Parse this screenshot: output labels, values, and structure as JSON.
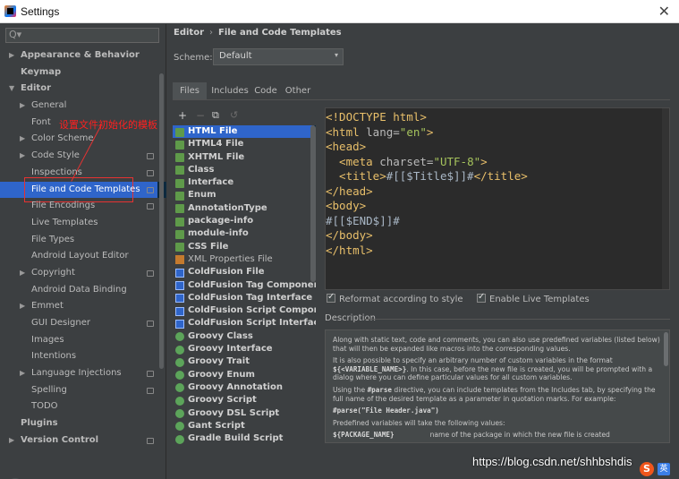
{
  "window": {
    "title": "Settings",
    "close_glyph": "✕"
  },
  "search": {
    "glyph": "Q▾"
  },
  "sidebar": {
    "items": [
      {
        "label": "Appearance & Behavior",
        "level": 0,
        "arrow": "▶",
        "bold": true
      },
      {
        "label": "Keymap",
        "level": 0,
        "arrow": "",
        "bold": true
      },
      {
        "label": "Editor",
        "level": 0,
        "arrow": "▼",
        "bold": true
      },
      {
        "label": "General",
        "level": 1,
        "arrow": "▶"
      },
      {
        "label": "Font",
        "level": 1,
        "arrow": ""
      },
      {
        "label": "Color Scheme",
        "level": 1,
        "arrow": "▶"
      },
      {
        "label": "Code Style",
        "level": 1,
        "arrow": "▶",
        "badge": true
      },
      {
        "label": "Inspections",
        "level": 1,
        "arrow": "",
        "badge": true
      },
      {
        "label": "File and Code Templates",
        "level": 1,
        "arrow": "",
        "badge": true,
        "selected": true
      },
      {
        "label": "File Encodings",
        "level": 1,
        "arrow": "",
        "badge": true
      },
      {
        "label": "Live Templates",
        "level": 1,
        "arrow": ""
      },
      {
        "label": "File Types",
        "level": 1,
        "arrow": ""
      },
      {
        "label": "Android Layout Editor",
        "level": 1,
        "arrow": ""
      },
      {
        "label": "Copyright",
        "level": 1,
        "arrow": "▶",
        "badge": true
      },
      {
        "label": "Android Data Binding",
        "level": 1,
        "arrow": ""
      },
      {
        "label": "Emmet",
        "level": 1,
        "arrow": "▶"
      },
      {
        "label": "GUI Designer",
        "level": 1,
        "arrow": "",
        "badge": true
      },
      {
        "label": "Images",
        "level": 1,
        "arrow": ""
      },
      {
        "label": "Intentions",
        "level": 1,
        "arrow": ""
      },
      {
        "label": "Language Injections",
        "level": 1,
        "arrow": "▶",
        "badge": true
      },
      {
        "label": "Spelling",
        "level": 1,
        "arrow": "",
        "badge": true
      },
      {
        "label": "TODO",
        "level": 1,
        "arrow": ""
      },
      {
        "label": "Plugins",
        "level": 0,
        "arrow": "",
        "bold": true
      },
      {
        "label": "Version Control",
        "level": 0,
        "arrow": "▶",
        "bold": true,
        "badge": true
      }
    ]
  },
  "annotation": {
    "text": "设置文件初始化的模板"
  },
  "help": {
    "glyph": "?"
  },
  "breadcrumb": {
    "part1": "Editor",
    "separator": "›",
    "part2": "File and Code Templates"
  },
  "scheme": {
    "label": "Scheme:",
    "value": "Default",
    "arrow": "▾"
  },
  "tabs": [
    {
      "label": "Files",
      "active": true
    },
    {
      "label": "Includes"
    },
    {
      "label": "Code"
    },
    {
      "label": "Other"
    }
  ],
  "toolbar": {
    "add": "+",
    "remove": "−",
    "copy": "⧉",
    "reset": "↺"
  },
  "templates": [
    {
      "label": "HTML File",
      "icon": "file",
      "selected": true
    },
    {
      "label": "HTML4 File",
      "icon": "file"
    },
    {
      "label": "XHTML File",
      "icon": "file"
    },
    {
      "label": "Class",
      "icon": "file"
    },
    {
      "label": "Interface",
      "icon": "file"
    },
    {
      "label": "Enum",
      "icon": "file"
    },
    {
      "label": "AnnotationType",
      "icon": "file"
    },
    {
      "label": "package-info",
      "icon": "file"
    },
    {
      "label": "module-info",
      "icon": "file"
    },
    {
      "label": "CSS File",
      "icon": "file"
    },
    {
      "label": "XML Properties File",
      "icon": "xml",
      "light": true
    },
    {
      "label": "ColdFusion File",
      "icon": "cf"
    },
    {
      "label": "ColdFusion Tag Component",
      "icon": "cf"
    },
    {
      "label": "ColdFusion Tag Interface",
      "icon": "cf"
    },
    {
      "label": "ColdFusion Script Component",
      "icon": "cf"
    },
    {
      "label": "ColdFusion Script Interface",
      "icon": "cf"
    },
    {
      "label": "Groovy Class",
      "icon": "groovy"
    },
    {
      "label": "Groovy Interface",
      "icon": "groovy"
    },
    {
      "label": "Groovy Trait",
      "icon": "groovy"
    },
    {
      "label": "Groovy Enum",
      "icon": "groovy"
    },
    {
      "label": "Groovy Annotation",
      "icon": "groovy"
    },
    {
      "label": "Groovy Script",
      "icon": "groovy"
    },
    {
      "label": "Groovy DSL Script",
      "icon": "groovy"
    },
    {
      "label": "Gant Script",
      "icon": "groovy"
    },
    {
      "label": "Gradle Build Script",
      "icon": "groovy"
    }
  ],
  "code": {
    "l1": "<!DOCTYPE html>",
    "l2a": "<html ",
    "l2b": "lang=",
    "l2c": "\"en\"",
    "l2d": ">",
    "l3": "<head>",
    "l4a": "  <meta ",
    "l4b": "charset=",
    "l4c": "\"UTF-8\"",
    "l4d": ">",
    "l5a": "  <title>",
    "l5b": "#[[$Title$]]#",
    "l5c": "</title>",
    "l6": "</head>",
    "l7": "<body>",
    "l8": "#[[$END$]]#",
    "l9": "</body>",
    "l10": "</html>"
  },
  "options": {
    "reformat": "Reformat according to style",
    "live": "Enable Live Templates"
  },
  "description": {
    "label": "Description",
    "p1": "Along with static text, code and comments, you can also use predefined variables (listed below) that will then be expanded like macros into the corresponding values.",
    "p2a": "It is also possible to specify an arbitrary number of custom variables in the format ",
    "p2b": "${<VARIABLE_NAME>}",
    "p2c": ". In this case, before the new file is created, you will be prompted with a dialog where you can define particular values for all custom variables.",
    "p3a": "Using the ",
    "p3b": "#parse",
    "p3c": " directive, you can include templates from the Includes tab, by specifying the full name of the desired template as a parameter in quotation marks. For example:",
    "p4": "#parse(\"File Header.java\")",
    "p5": "Predefined variables will take the following values:",
    "p6a": "${PACKAGE_NAME}",
    "p6b": "name of the package in which the new file is created"
  },
  "watermark": {
    "text": "https://blog.csdn.net/shhbshdis",
    "s": "S",
    "y": "英"
  }
}
